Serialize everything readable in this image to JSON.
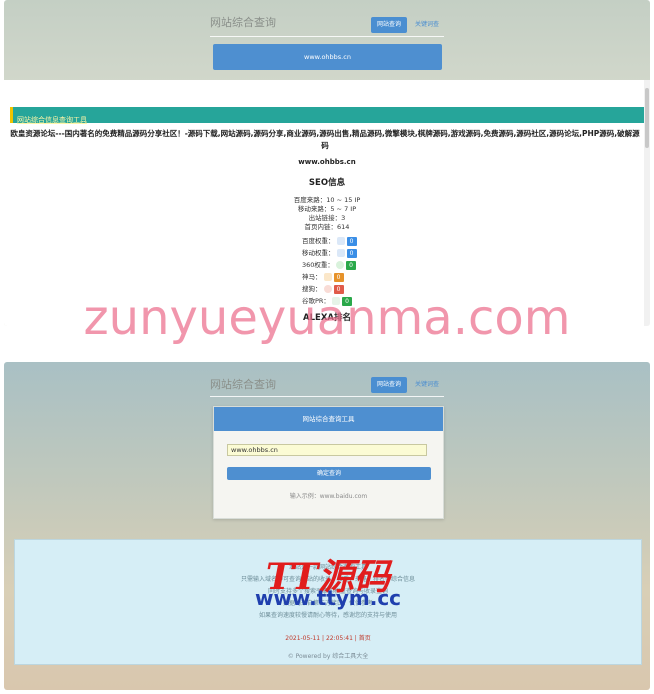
{
  "top": {
    "title": "网站综合查询",
    "tabs": [
      {
        "label": "网站查询",
        "active": true
      },
      {
        "label": "关键词查",
        "active": false
      }
    ],
    "domain": "www.ohbbs.cn"
  },
  "results": {
    "heading": "网站综合信息查询工具",
    "site_desc": "欧皇资源论坛---国内著名的免费精品源码分享社区！-源码下载,网站源码,源码分享,商业源码,源码出售,精品源码,微擎模块,棋牌源码,游戏源码,免费源码,源码社区,源码论坛,PHP源码,破解源码",
    "domain": "www.ohbbs.cn",
    "seo_heading": "SEO信息",
    "seo_lines": [
      "百度来路：10 ~ 15 IP",
      "移动来路：5 ~ 7 IP",
      "出站链接：3",
      "首页内链：614"
    ],
    "rankings": [
      {
        "label": "百度权重：",
        "value": "0",
        "color": "#3a8ee6"
      },
      {
        "label": "移动权重：",
        "value": "0",
        "color": "#3a8ee6"
      },
      {
        "label": "360权重：",
        "value": "0",
        "color": "#2aa84a"
      },
      {
        "label": "神马：",
        "value": "0",
        "color": "#e6922a"
      },
      {
        "label": "搜狗：",
        "value": "0",
        "color": "#e05b4a"
      },
      {
        "label": "谷歌PR：",
        "value": "0",
        "color": "#2aa84a"
      }
    ],
    "alexa_heading": "ALEXA排名"
  },
  "watermark": "zunyueyuanma.com",
  "bottom": {
    "title": "网站综合查询",
    "tabs": [
      {
        "label": "网站查询",
        "active": true
      },
      {
        "label": "关键词查",
        "active": false
      }
    ],
    "card_title": "网站综合查询工具",
    "input_value": "www.ohbbs.cn",
    "button_label": "确定查询",
    "example": "输入示例：www.baidu.com",
    "info_lines": [
      "本站是一款网站综合查询工具",
      "只需输入域名即可查询网站的收录、权重、来路、排名等综合信息",
      "同时支持多个搜索引擎的权重查询与收录查询",
      "数据均来自第三方接口，仅供参考",
      "如果查询速度较慢请耐心等待，感谢您的支持与使用"
    ],
    "footer_meta": "2021-05-11 | 22:05:41 | 首页",
    "footer_power": "© Powered by 综合工具大全"
  },
  "logo": {
    "cn_text": "TT源码",
    "url": "www.ttym.cc"
  }
}
